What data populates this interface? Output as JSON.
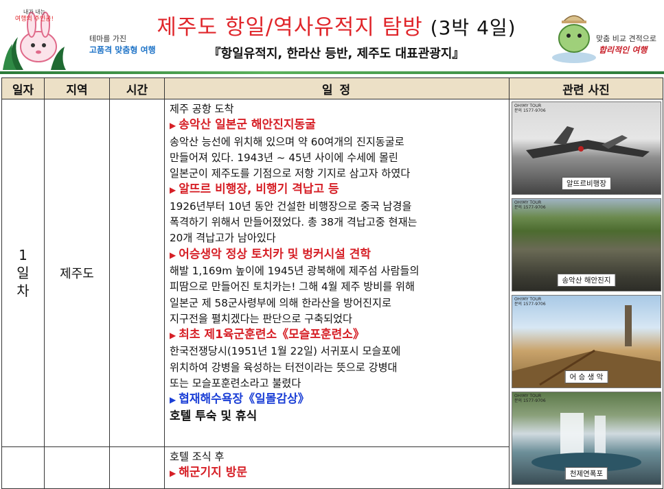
{
  "header": {
    "left_logo_small": "내가 내는 여행의 주인공!",
    "left_tagline1": "테마를 가진",
    "left_tagline2": "고품격 맞춤형 여행",
    "title_main": "제주도 항일/역사유적지 탐방",
    "title_duration": "(3박 4일)",
    "subtitle": "『항일유적지, 한라산 등반, 제주도 대표관광지』",
    "right_tagline1": "맞춤 비교 견적으로",
    "right_tagline2": "합리적인 여행"
  },
  "table": {
    "headers": [
      "일자",
      "지역",
      "시간",
      "일 정",
      "관련 사진"
    ],
    "day1": {
      "day_label": "1 일 차",
      "region": "제주도",
      "time": "",
      "schedule": [
        {
          "style": "plain",
          "text": "제주 공항 도착"
        },
        {
          "style": "red",
          "text": "송악산 일본군 해안진지동굴"
        },
        {
          "style": "plain",
          "text": "송악산 능선에 위치해 있으며 약 60여개의 진지동굴로"
        },
        {
          "style": "plain",
          "text": "만들어져 있다. 1943년  ~  45년 사이에 수세에 몰린"
        },
        {
          "style": "plain",
          "text": "일본군이 제주도를 기점으로 저항 기지로 삼고자 하였다"
        },
        {
          "style": "red",
          "text": "알뜨르 비행장, 비행기 격납고 등"
        },
        {
          "style": "plain",
          "text": "1926년부터 10년 동안 건설한 비행장으로 중국 남경을"
        },
        {
          "style": "plain",
          "text": "폭격하기 위해서 만들어졌었다. 총 38개 격납고중 현재는"
        },
        {
          "style": "plain",
          "text": "20개 격납고가 남아있다"
        },
        {
          "style": "red",
          "text": "어승생악 정상 토치카 및 벙커시설 견학"
        },
        {
          "style": "plain",
          "text": "해발 1,169m 높이에 1945년 광복해에 제주섬 사람들의"
        },
        {
          "style": "plain",
          "text": "피땀으로 만들어진 토치카는! 그해 4월 제주 방비를 위해"
        },
        {
          "style": "plain",
          "text": "일본군 제 58군사령부에 의해 한라산을 방어진지로"
        },
        {
          "style": "plain",
          "text": "지구전을 펼치겠다는 판단으로 구축되었다"
        },
        {
          "style": "red",
          "text": "최초 제1육군훈련소《모슬포훈련소》"
        },
        {
          "style": "plain",
          "text": "한국전쟁당시(1951년 1월 22일) 서귀포시 모슬포에"
        },
        {
          "style": "plain",
          "text": "위치하여 강병을 육성하는 터전이라는 뜻으로 강병대"
        },
        {
          "style": "plain",
          "text": "또는 모슬포훈련소라고 불렸다"
        },
        {
          "style": "blue",
          "text": "협재해수욕장《일몰감상》"
        },
        {
          "style": "bold",
          "text": "호텔 투숙 및 휴식"
        }
      ]
    },
    "day2": {
      "schedule": [
        {
          "style": "plain",
          "text": "호텔 조식 후"
        },
        {
          "style": "red",
          "text": "해군기지 방문"
        }
      ]
    },
    "photos": [
      {
        "caption": "알뜨르비행장",
        "tag1": "OH!MY TOUR",
        "tag2": "문의 1577-9706"
      },
      {
        "caption": "송악산 해안진지",
        "tag1": "OH!MY TOUR",
        "tag2": "문의 1577-9706"
      },
      {
        "caption": "어 승 생 악",
        "tag1": "OH!MY TOUR",
        "tag2": "문의 1577-9706"
      },
      {
        "caption": "천제연폭포",
        "tag1": "OH!MY TOUR",
        "tag2": "문의 1577-9706"
      }
    ]
  },
  "colors": {
    "title_red": "#e0262b",
    "highlight_red": "#d61f26",
    "highlight_blue": "#1b3fd6",
    "header_bg": "#ece0c6",
    "accent_green": "#2c7a3a"
  }
}
